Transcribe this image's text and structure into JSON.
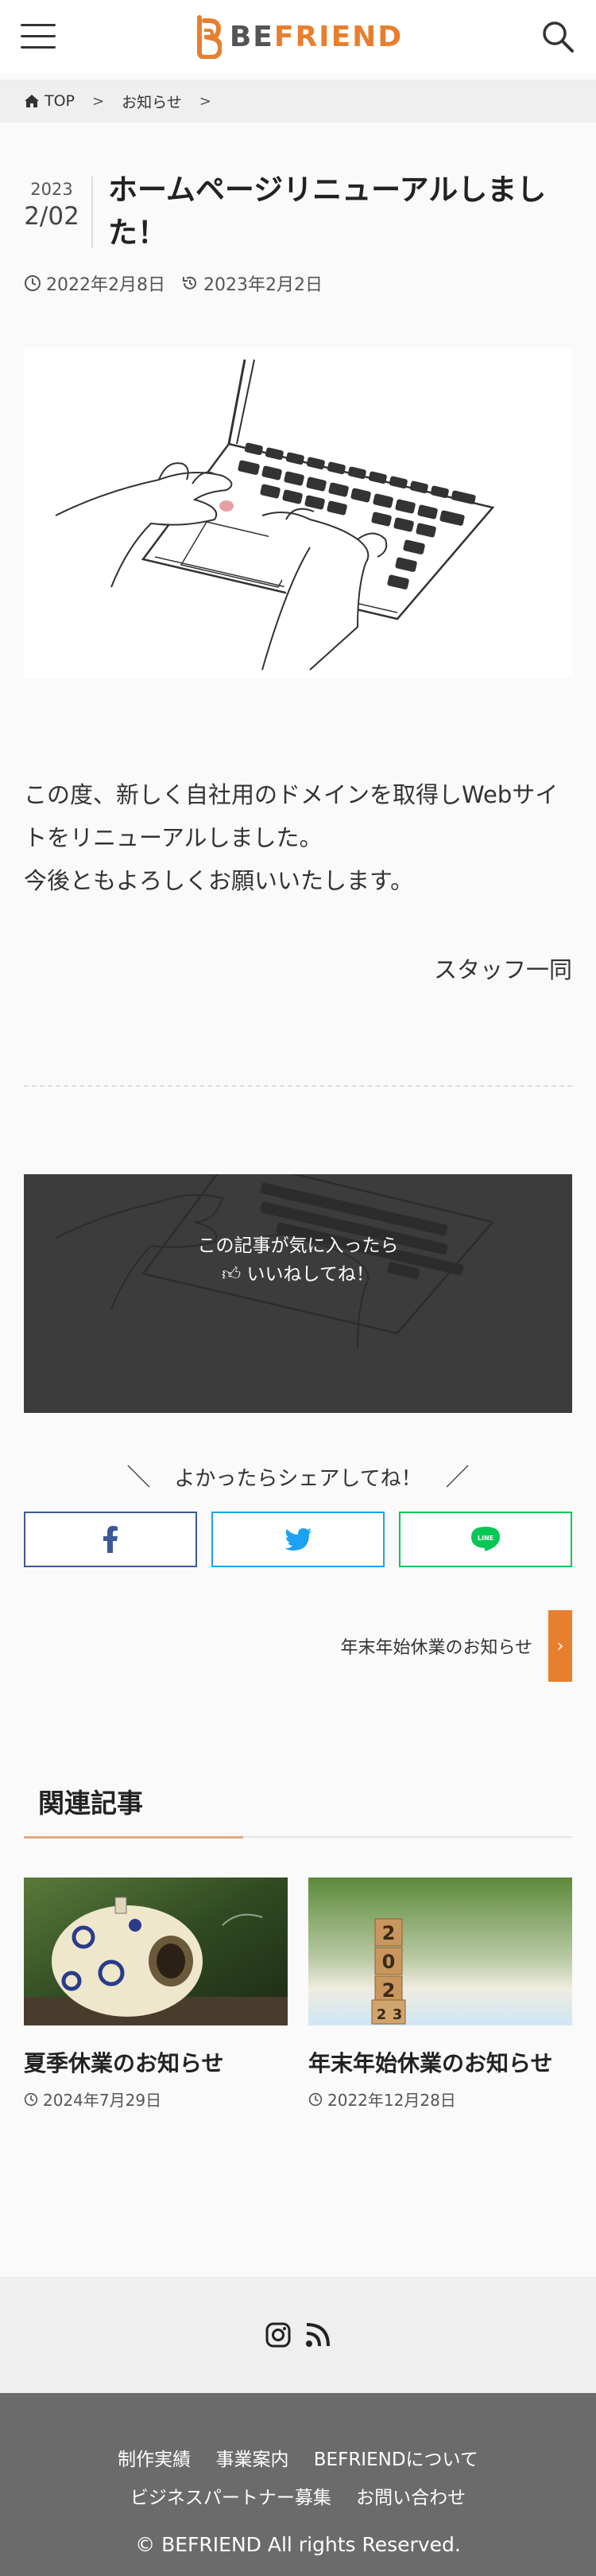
{
  "header": {
    "logo_be": "BE",
    "logo_friend": "FRIEND"
  },
  "breadcrumb": {
    "home": "TOP",
    "category": "お知らせ"
  },
  "article": {
    "year": "2023",
    "month_day": "2/02",
    "title": "ホームページリニューアルしました！",
    "updated": "2022年2月8日",
    "published": "2023年2月2日",
    "body_line1": "この度、新しく自社用のドメインを取得しWebサイトをリニューアルしました。",
    "body_line2": "今後ともよろしくお願いいたします。",
    "signature": "スタッフ一同"
  },
  "like": {
    "line1": "この記事が気に入ったら",
    "line2": "いいねしてね！"
  },
  "share": {
    "title": "よかったらシェアしてね！",
    "line_label": "LINE"
  },
  "next": {
    "label": "年末年始休業のお知らせ"
  },
  "related": {
    "heading": "関連記事",
    "cards": [
      {
        "title": "夏季休業のお知らせ",
        "date": "2024年7月29日"
      },
      {
        "title": "年末年始休業のお知らせ",
        "date": "2022年12月28日"
      }
    ]
  },
  "footer": {
    "nav": [
      "制作実績",
      "事業案内",
      "BEFRIENDについて",
      "ビジネスパートナー募集",
      "お問い合わせ"
    ],
    "copyright": "© BEFRIEND All rights Reserved."
  },
  "colors": {
    "accent": "#e87f2e",
    "facebook": "#3b5998",
    "twitter": "#1da1f2",
    "line": "#06c755",
    "footer_bg": "#6b6b6b"
  }
}
